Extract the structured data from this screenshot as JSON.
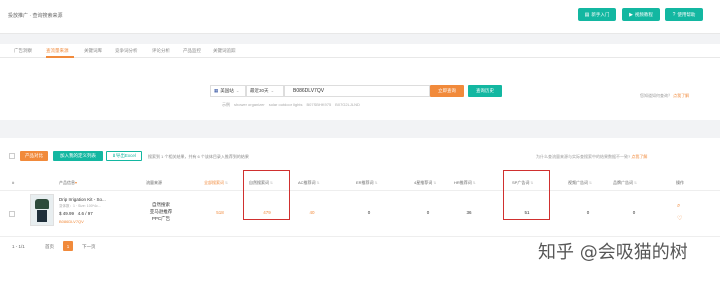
{
  "breadcrumb": "投放推广 · 查询搜索来源",
  "top_buttons": [
    {
      "label": "新手入门",
      "icon": "book-icon"
    },
    {
      "label": "视频教程",
      "icon": "play-icon"
    },
    {
      "label": "使用帮助",
      "icon": "help-icon"
    }
  ],
  "tabs": [
    "广告洞察",
    "查流量来源",
    "关键词库",
    "竞争词分析",
    "评论分析",
    "产品监控",
    "关键词追踪"
  ],
  "active_tab_index": 1,
  "search": {
    "marketplace": "美国站",
    "period": "最近30天",
    "asin": "B086DLV7QV",
    "query_button": "立即查询",
    "history_button": "查询历史",
    "hot_label": "示例",
    "hot_words": [
      "shower organizer",
      "solar outdoor lights",
      "B07SBHK975",
      "B07G2LJLND"
    ],
    "right_link_prefix": "您知道如何查询？",
    "right_link": "点我了解"
  },
  "toolbar": {
    "product_compare": "产品对比",
    "add_custom_list": "加入我的定义列表",
    "export_excel": "导出Excel",
    "hint": "搜索到 1 个相关结果，共有 6 个该体目录入推荐到的结果",
    "right_hint_prefix": "为什么查流量来源与实际查搜索中的结果数据不一致?",
    "right_hint_link": "点我了解"
  },
  "columns": [
    "#",
    "产品信息",
    "流量来源",
    "全部搜索词",
    "自然搜索词",
    "AC推荐词",
    "ER推荐词",
    "4星推荐词",
    "HR推荐词",
    "SP广告词",
    "视频广告词",
    "品牌广告词",
    "操作"
  ],
  "columns_underlined": [
    "产品信息",
    "全部搜索词"
  ],
  "rows": [
    {
      "name": "Drip Irrigation Kit - So...",
      "meta": "变体数：1 · Size: 100*4c...",
      "price": "$ 49.99",
      "rating": "4.6 / 97",
      "asin": "B086DLV7QV",
      "sources": [
        "自然搜索",
        "亚马逊推荐",
        "PPC广告"
      ],
      "all_terms": "518",
      "natural": "479",
      "ac": "40",
      "er": "0",
      "star4": "0",
      "hr": "36",
      "sp": "51",
      "video": "0",
      "brand": "0"
    }
  ],
  "pagination": {
    "range": "1 - 1/1",
    "prev": "首页",
    "current": "1",
    "next": "下一页"
  },
  "watermark": "知乎 @会吸猫的树",
  "colors": {
    "accent": "#f18a3b",
    "teal": "#13b7a1",
    "highlight_box": "#d0302f"
  }
}
